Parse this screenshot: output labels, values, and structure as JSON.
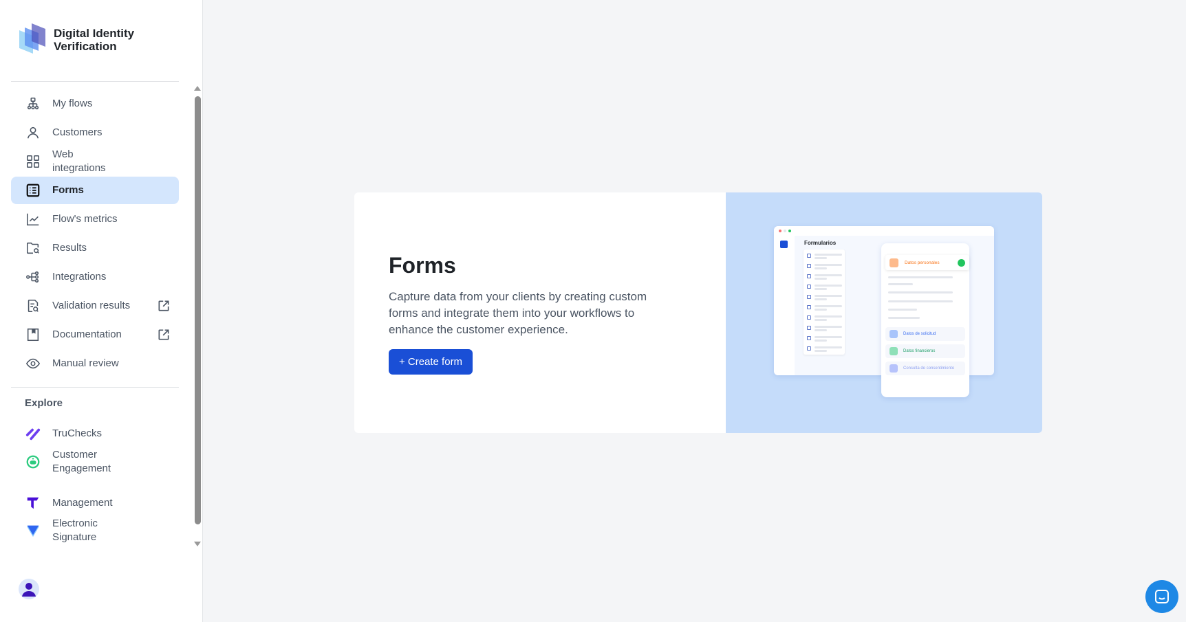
{
  "app": {
    "title": "Digital Identity Verification"
  },
  "sidebar": {
    "items": [
      {
        "label": "My flows",
        "icon": "sitemap-icon"
      },
      {
        "label": "Customers",
        "icon": "user-icon"
      },
      {
        "label": "Web integrations",
        "icon": "grid-icon"
      },
      {
        "label": "Forms",
        "icon": "form-list-icon",
        "active": true
      },
      {
        "label": "Flow's metrics",
        "icon": "chart-line-icon"
      },
      {
        "label": "Results",
        "icon": "folder-search-icon"
      },
      {
        "label": "Integrations",
        "icon": "integrations-icon"
      },
      {
        "label": "Validation results",
        "icon": "document-search-icon",
        "external": true
      },
      {
        "label": "Documentation",
        "icon": "book-icon",
        "external": true
      },
      {
        "label": "Manual review",
        "icon": "eye-icon"
      }
    ],
    "explore_label": "Explore",
    "explore": [
      {
        "label": "TruChecks",
        "icon": "truchecks-logo-icon"
      },
      {
        "label": "Customer Engagement",
        "icon": "chat-bot-icon"
      },
      {
        "label": "Management",
        "icon": "management-logo-icon"
      },
      {
        "label": "Electronic Signature",
        "icon": "signature-triangle-icon"
      }
    ]
  },
  "main": {
    "title": "Forms",
    "description": "Capture data from your clients by creating custom forms and integrate them into your workflows to enhance the customer experience.",
    "create_button": "+ Create form",
    "illustration": {
      "window_title": "Formularios",
      "sections": [
        "Datos personales",
        "Datos de solicitud",
        "Datos financieros",
        "Consulta de consentimiento"
      ]
    }
  },
  "colors": {
    "accent": "#1a4fd6",
    "active_bg": "#d4e6fd",
    "illustration_bg": "#c5dcfa"
  }
}
